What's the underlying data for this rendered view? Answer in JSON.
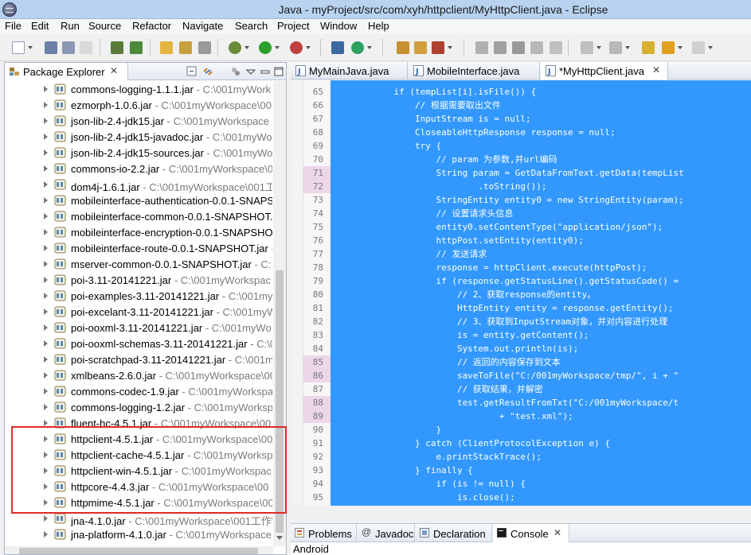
{
  "window": {
    "title": "Java - myProject/src/com/xyh/httpclient/MyHttpClient.java - Eclipse"
  },
  "menu": [
    "File",
    "Edit",
    "Run",
    "Source",
    "Refactor",
    "Navigate",
    "Search",
    "Project",
    "Window",
    "Help"
  ],
  "package_explorer": {
    "title": "Package Explorer",
    "close": "✕",
    "items": [
      {
        "name": "commons-logging-1.1.1.jar",
        "path": " - C:\\001myWork"
      },
      {
        "name": "ezmorph-1.0.6.jar",
        "path": " - C:\\001myWorkspace\\00"
      },
      {
        "name": "json-lib-2.4-jdk15.jar",
        "path": " - C:\\001myWorkspace"
      },
      {
        "name": "json-lib-2.4-jdk15-javadoc.jar",
        "path": " - C:\\001myWo"
      },
      {
        "name": "json-lib-2.4-jdk15-sources.jar",
        "path": " - C:\\001myWo"
      },
      {
        "name": "commons-io-2.2.jar",
        "path": " - C:\\001myWorkspace\\0"
      },
      {
        "name": "dom4j-1.6.1.jar",
        "path": " - C:\\001myWorkspace\\001工"
      },
      {
        "name": "mobileinterface-authentication-0.0.1-SNAPSH",
        "path": ""
      },
      {
        "name": "mobileinterface-common-0.0.1-SNAPSHOT.j",
        "path": ""
      },
      {
        "name": "mobileinterface-encryption-0.0.1-SNAPSHOT",
        "path": ""
      },
      {
        "name": "mobileinterface-route-0.0.1-SNAPSHOT.jar",
        "path": " -"
      },
      {
        "name": "mserver-common-0.0.1-SNAPSHOT.jar",
        "path": " - C:"
      },
      {
        "name": "poi-3.11-20141221.jar",
        "path": " - C:\\001myWorkspac"
      },
      {
        "name": "poi-examples-3.11-20141221.jar",
        "path": " - C:\\001my"
      },
      {
        "name": "poi-excelant-3.11-20141221.jar",
        "path": " - C:\\001myW"
      },
      {
        "name": "poi-ooxml-3.11-20141221.jar",
        "path": " - C:\\001myWo"
      },
      {
        "name": "poi-ooxml-schemas-3.11-20141221.jar",
        "path": " - C:\\0"
      },
      {
        "name": "poi-scratchpad-3.11-20141221.jar",
        "path": " - C:\\001m"
      },
      {
        "name": "xmlbeans-2.6.0.jar",
        "path": " - C:\\001myWorkspace\\00"
      },
      {
        "name": "commons-codec-1.9.jar",
        "path": " - C:\\001myWorkspa"
      },
      {
        "name": "commons-logging-1.2.jar",
        "path": " - C:\\001myWorksp"
      },
      {
        "name": "fluent-hc-4.5.1.jar",
        "path": " - C:\\001myWorkspace\\00"
      },
      {
        "name": "httpclient-4.5.1.jar",
        "path": " - C:\\001myWorkspace\\00"
      },
      {
        "name": "httpclient-cache-4.5.1.jar",
        "path": " - C:\\001myWorksp"
      },
      {
        "name": "httpclient-win-4.5.1.jar",
        "path": " - C:\\001myWorkspac"
      },
      {
        "name": "httpcore-4.4.3.jar",
        "path": " - C:\\001myWorkspace\\00"
      },
      {
        "name": "httpmime-4.5.1.jar",
        "path": " - C:\\001myWorkspace\\00"
      },
      {
        "name": "jna-4.1.0.jar",
        "path": " - C:\\001myWorkspace\\001工作\\"
      },
      {
        "name": "jna-platform-4.1.0.jar",
        "path": " - C:\\001myWorkspace"
      }
    ]
  },
  "editor": {
    "tabs": [
      {
        "label": "MyMainJava.java",
        "active": false
      },
      {
        "label": "MobileInterface.java",
        "active": false
      },
      {
        "label": "*MyHttpClient.java",
        "active": true
      }
    ],
    "tab_close": "✕",
    "lines": [
      {
        "num": "65",
        "code": "            if (tempList[i].isFile()) {",
        "changed": false
      },
      {
        "num": "66",
        "code": "                // 根据需要取出文件",
        "changed": false
      },
      {
        "num": "67",
        "code": "                InputStream is = null;",
        "changed": false
      },
      {
        "num": "68",
        "code": "                CloseableHttpResponse response = null;",
        "changed": false
      },
      {
        "num": "69",
        "code": "                try {",
        "changed": false
      },
      {
        "num": "70",
        "code": "                    // param 为参数,并url编码",
        "changed": false
      },
      {
        "num": "71",
        "code": "                    String param = GetDataFromText.getData(tempList",
        "changed": true
      },
      {
        "num": "72",
        "code": "                            .toString());",
        "changed": true
      },
      {
        "num": "73",
        "code": "                    StringEntity entity0 = new StringEntity(param);",
        "changed": false
      },
      {
        "num": "74",
        "code": "                    // 设置请求头信息",
        "changed": false
      },
      {
        "num": "75",
        "code": "                    entity0.setContentType(\"application/json\");",
        "changed": false
      },
      {
        "num": "76",
        "code": "                    httpPost.setEntity(entity0);",
        "changed": false
      },
      {
        "num": "77",
        "code": "                    // 发送请求",
        "changed": false
      },
      {
        "num": "78",
        "code": "                    response = httpClient.execute(httpPost);",
        "changed": false
      },
      {
        "num": "79",
        "code": "                    if (response.getStatusLine().getStatusCode() =",
        "changed": false
      },
      {
        "num": "80",
        "code": "                        // 2、获取response的entity。",
        "changed": false
      },
      {
        "num": "81",
        "code": "                        HttpEntity entity = response.getEntity();",
        "changed": false
      },
      {
        "num": "82",
        "code": "                        // 3、获取到InputStream对象，并对内容进行处理",
        "changed": false
      },
      {
        "num": "83",
        "code": "                        is = entity.getContent();",
        "changed": false
      },
      {
        "num": "84",
        "code": "                        System.out.println(is);",
        "changed": false
      },
      {
        "num": "85",
        "code": "                        // 返回的内容保存到文本",
        "changed": true
      },
      {
        "num": "86",
        "code": "                        saveToFile(\"C:/001myWorkspace/tmp/\", i + \"",
        "changed": true
      },
      {
        "num": "87",
        "code": "                        // 获取结果，并解密",
        "changed": false
      },
      {
        "num": "88",
        "code": "                        test.getResultFromTxt(\"C:/001myWorkspace/t",
        "changed": true
      },
      {
        "num": "89",
        "code": "                                + \"test.xml\");",
        "changed": true
      },
      {
        "num": "90",
        "code": "                    }",
        "changed": false
      },
      {
        "num": "91",
        "code": "                } catch (ClientProtocolException e) {",
        "changed": false
      },
      {
        "num": "92",
        "code": "                    e.printStackTrace();",
        "changed": false
      },
      {
        "num": "93",
        "code": "                } finally {",
        "changed": false
      },
      {
        "num": "94",
        "code": "                    if (is != null) {",
        "changed": false
      },
      {
        "num": "95",
        "code": "                        is.close();",
        "changed": false
      }
    ]
  },
  "bottom_panel": {
    "tabs": [
      {
        "label": "Problems",
        "active": false
      },
      {
        "label": "Javadoc",
        "active": false
      },
      {
        "label": "Declaration",
        "active": false
      },
      {
        "label": "Console",
        "active": true
      }
    ],
    "tab_close": "✕",
    "console_text": "Android"
  },
  "colors": {
    "selection": "#3298fe",
    "highlight_box": "#e02a2a",
    "changed_line": "#ecd7ea"
  }
}
